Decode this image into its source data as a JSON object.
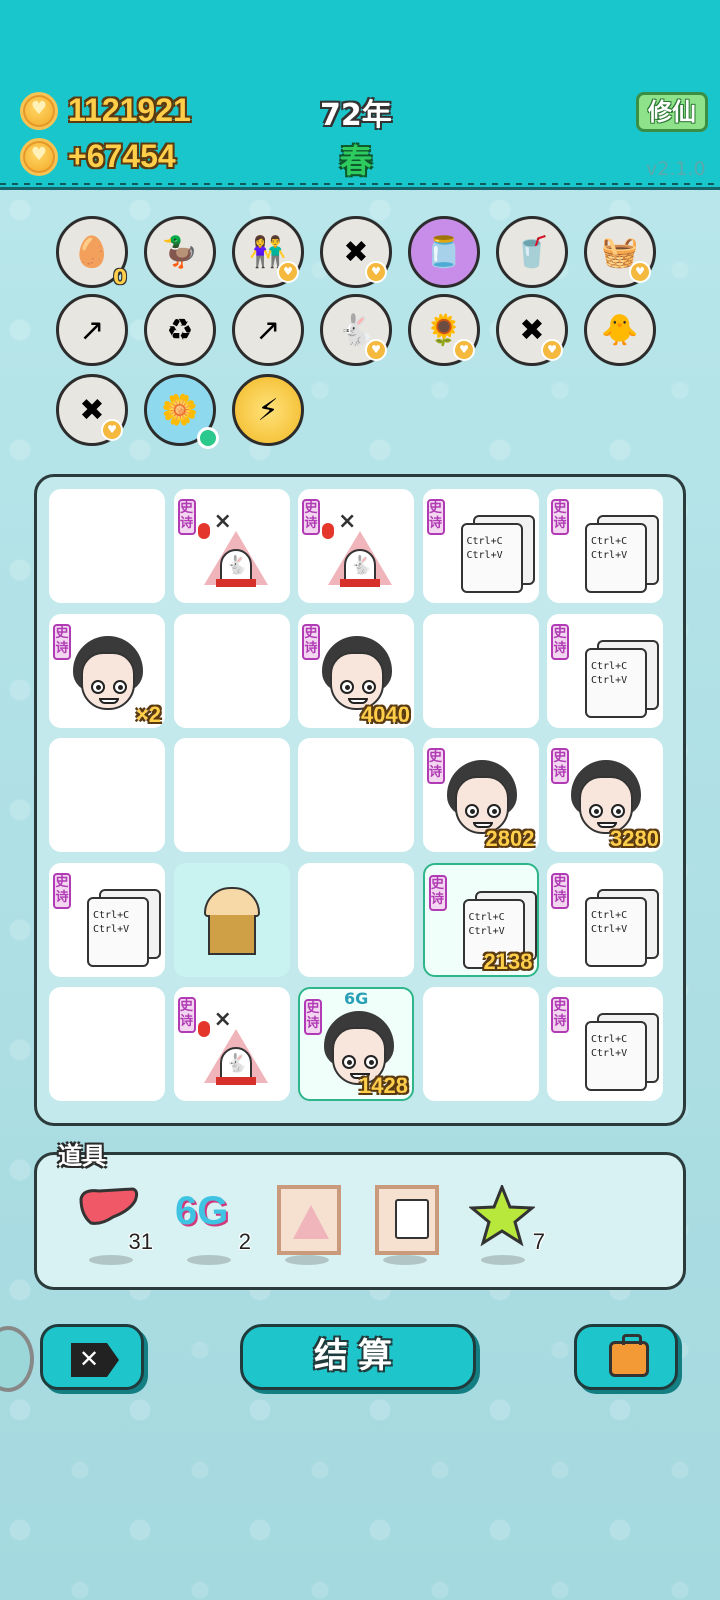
{
  "header": {
    "coins": "1121921",
    "income": "+67454",
    "year": "72年",
    "season": "春",
    "xiuxian_button": "修仙",
    "version": "v2.1.0"
  },
  "relics": [
    {
      "icon": "egg-tray-icon",
      "glyph": "🥚",
      "count": "0"
    },
    {
      "icon": "duck-pot-icon",
      "glyph": "🦆"
    },
    {
      "icon": "couple-icon",
      "glyph": "👫"
    },
    {
      "icon": "skip-tag-icon",
      "glyph": "✖"
    },
    {
      "icon": "jar-icon",
      "glyph": "🫙"
    },
    {
      "icon": "milk-tea-icon",
      "glyph": "🥤"
    },
    {
      "icon": "fruit-basket-icon",
      "glyph": "🧺"
    },
    {
      "icon": "upgrade-arrow-icon",
      "glyph": "↗"
    },
    {
      "icon": "recycle-bag-icon",
      "glyph": "♻"
    },
    {
      "icon": "upgrade-arrow-icon",
      "glyph": "↗"
    },
    {
      "icon": "rabbit-icon",
      "glyph": "🐇"
    },
    {
      "icon": "sunflower-icon",
      "glyph": "🌻"
    },
    {
      "icon": "skip-tag-icon",
      "glyph": "✖"
    },
    {
      "icon": "chick-egg-icon",
      "glyph": "🐥"
    },
    {
      "icon": "skip-tag-icon",
      "glyph": "✖"
    },
    {
      "icon": "potted-flower-icon",
      "glyph": "🌼"
    },
    {
      "icon": "lightning-icon",
      "glyph": "⚡"
    }
  ],
  "board": {
    "tag": "史诗",
    "paper_text": "Ctrl+C\nCtrl+V",
    "cells": [
      {
        "type": "empty"
      },
      {
        "type": "tent"
      },
      {
        "type": "tent"
      },
      {
        "type": "paper"
      },
      {
        "type": "paper"
      },
      {
        "type": "face",
        "value": "×2"
      },
      {
        "type": "empty"
      },
      {
        "type": "face",
        "value": "4040"
      },
      {
        "type": "empty"
      },
      {
        "type": "paper"
      },
      {
        "type": "empty"
      },
      {
        "type": "empty"
      },
      {
        "type": "empty"
      },
      {
        "type": "face",
        "value": "2802"
      },
      {
        "type": "face",
        "value": "3280"
      },
      {
        "type": "paper"
      },
      {
        "type": "cup"
      },
      {
        "type": "empty"
      },
      {
        "type": "paper",
        "value": "2138"
      },
      {
        "type": "paper"
      },
      {
        "type": "empty"
      },
      {
        "type": "tent"
      },
      {
        "type": "face",
        "value": "1428",
        "label": "6G"
      },
      {
        "type": "empty"
      },
      {
        "type": "paper"
      }
    ]
  },
  "items": {
    "label": "道具",
    "list": [
      {
        "icon": "liver-icon",
        "count": "31"
      },
      {
        "icon": "6g-icon",
        "text": "6G",
        "count": "2"
      },
      {
        "icon": "tent-card-icon"
      },
      {
        "icon": "paper-card-icon"
      },
      {
        "icon": "star-icon",
        "count": "7"
      }
    ]
  },
  "buttons": {
    "settle": "结算"
  },
  "colors": {
    "header_bg": "#19c6cb",
    "gold_text": "#ffcf4a",
    "button_bg": "#1ec6cc",
    "tag_purple": "#b03bb5"
  }
}
